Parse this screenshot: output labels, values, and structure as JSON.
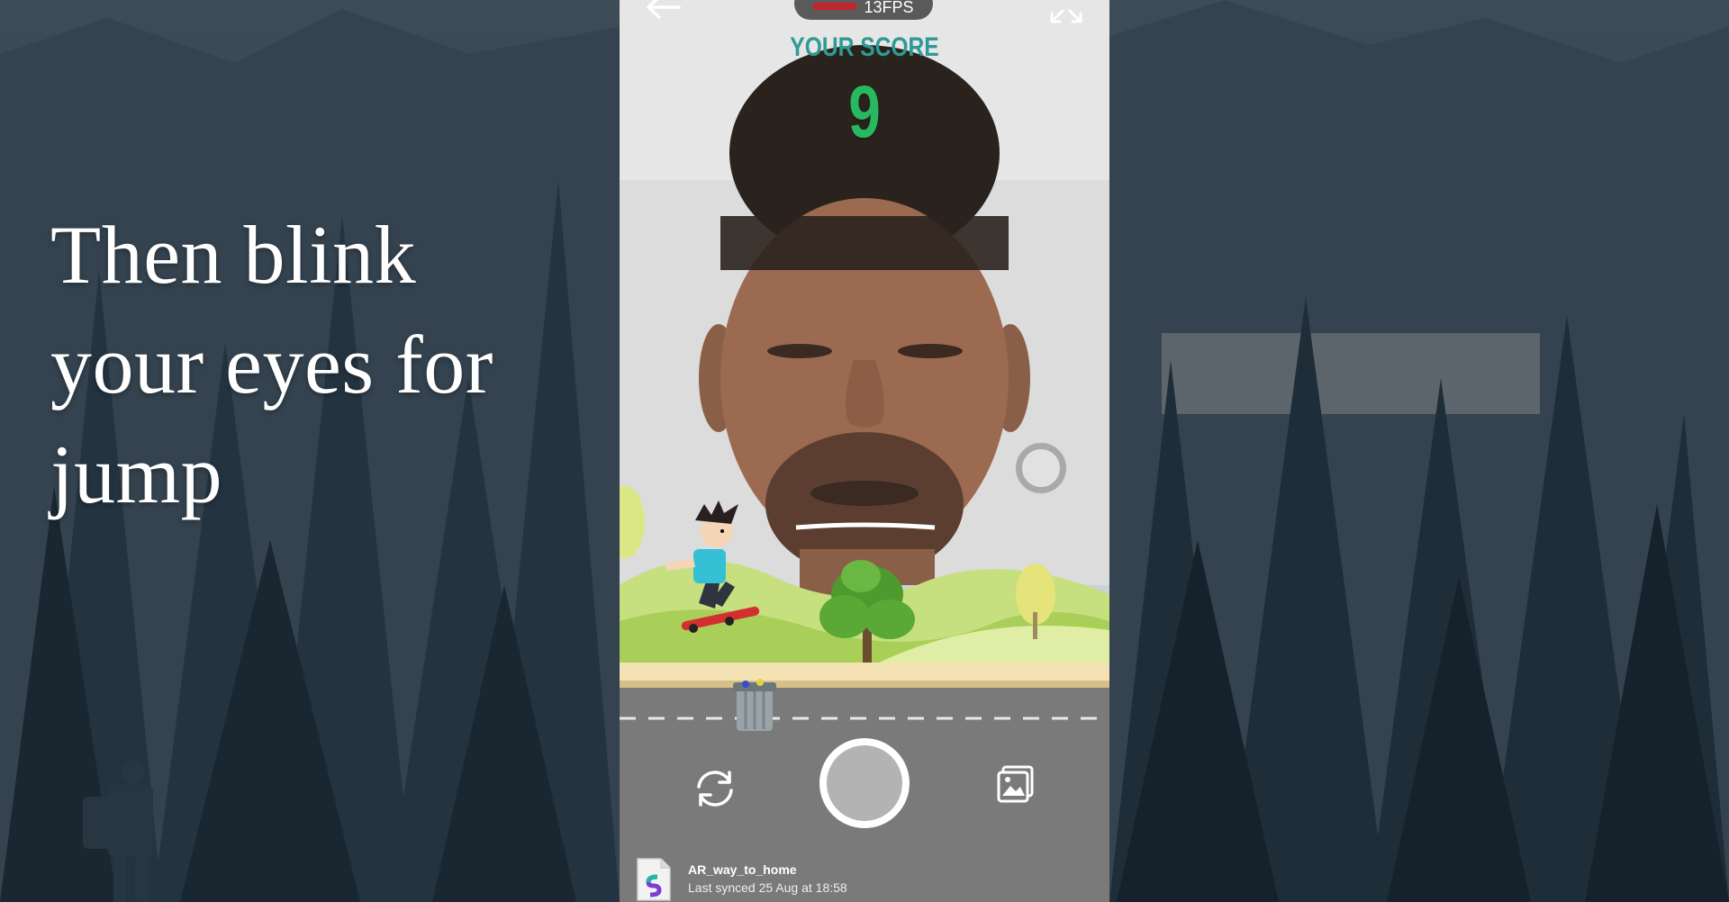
{
  "caption": {
    "line1": "Then blink",
    "line2": "your eyes for",
    "line3": "jump"
  },
  "status": {
    "fps_text": "13FPS"
  },
  "game": {
    "score_label": "YOUR SCORE",
    "score_value": "9"
  },
  "project": {
    "name": "AR_way_to_home",
    "last_synced": "Last synced 25 Aug at 18:58"
  },
  "icons": {
    "back": "back-arrow-icon",
    "expand": "expand-icon",
    "switch_camera": "switch-camera-icon",
    "gallery": "gallery-icon",
    "file": "file-icon"
  },
  "colors": {
    "score_label": "#2f9a95",
    "score_value": "#27b860",
    "fps_indicator": "#c0272d"
  }
}
